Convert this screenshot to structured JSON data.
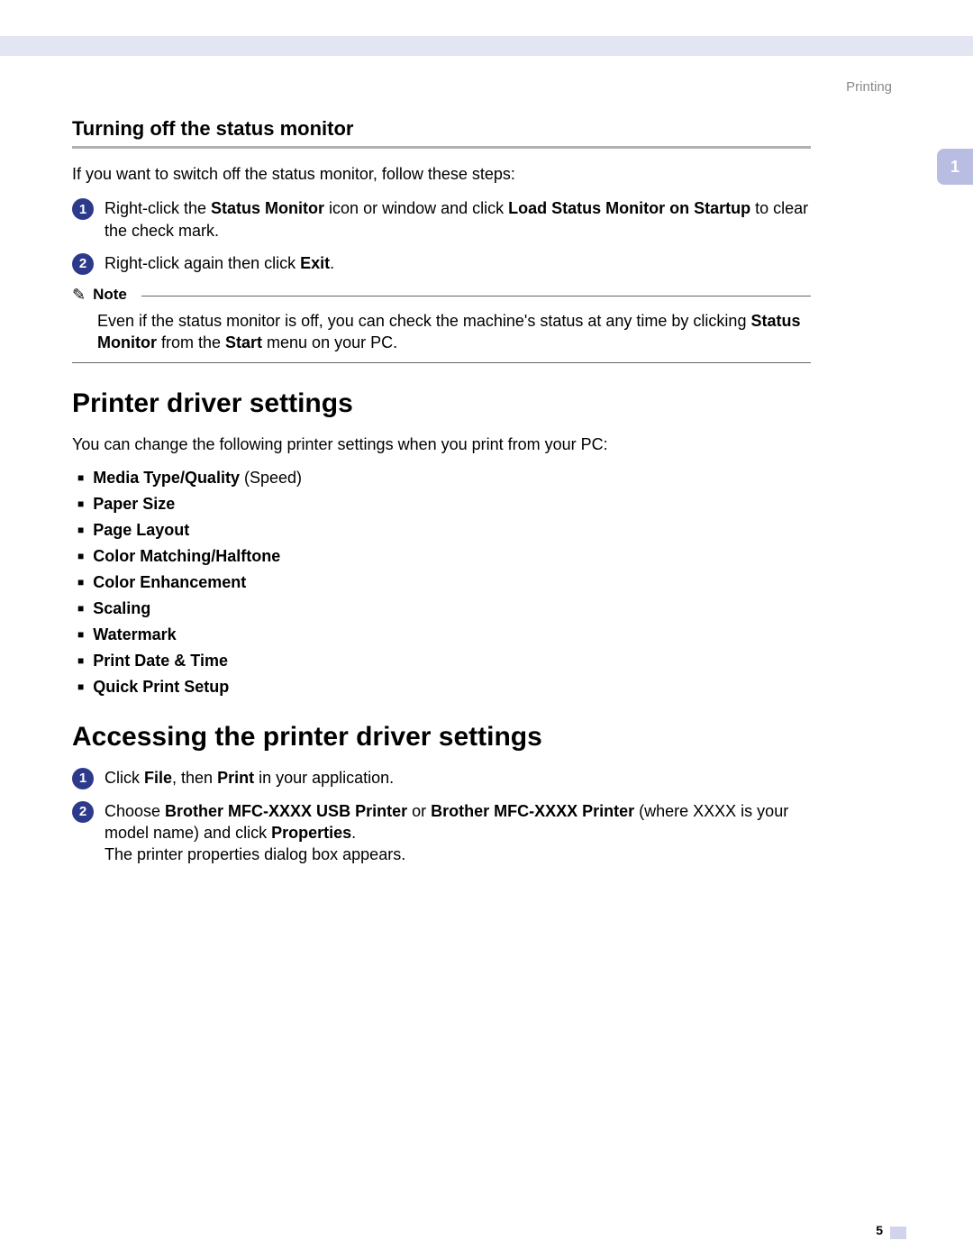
{
  "header": {
    "section_label": "Printing",
    "chapter_tab": "1"
  },
  "sub1": {
    "title": "Turning off the status monitor",
    "intro": "If you want to switch off the status monitor, follow these steps:",
    "step1": {
      "num": "1",
      "pre": "Right-click the ",
      "b1": "Status Monitor",
      "mid": " icon or window and click ",
      "b2": "Load Status Monitor on Startup",
      "post": " to clear the check mark."
    },
    "step2": {
      "num": "2",
      "pre": "Right-click again then click ",
      "b1": "Exit",
      "post": "."
    }
  },
  "note": {
    "label": "Note",
    "body_pre": "Even if the status monitor is off, you can check the machine's status at any time by clicking ",
    "body_b1": "Status Monitor",
    "body_mid": " from the ",
    "body_b2": "Start",
    "body_post": " menu on your PC."
  },
  "sec2": {
    "title": "Printer driver settings",
    "intro": "You can change the following printer settings when you print from your PC:",
    "items": [
      {
        "bold": "Media Type/Quality",
        "rest": " (Speed)"
      },
      {
        "bold": "Paper Size",
        "rest": ""
      },
      {
        "bold": "Page Layout",
        "rest": ""
      },
      {
        "bold": "Color Matching/Halftone",
        "rest": ""
      },
      {
        "bold": "Color Enhancement",
        "rest": ""
      },
      {
        "bold": "Scaling",
        "rest": ""
      },
      {
        "bold": "Watermark",
        "rest": ""
      },
      {
        "bold": "Print Date & Time",
        "rest": ""
      },
      {
        "bold": "Quick Print Setup",
        "rest": ""
      }
    ]
  },
  "sec3": {
    "title": "Accessing the printer driver settings",
    "step1": {
      "num": "1",
      "pre": "Click ",
      "b1": "File",
      "mid": ", then ",
      "b2": "Print",
      "post": " in your application."
    },
    "step2": {
      "num": "2",
      "pre": "Choose ",
      "b1": "Brother MFC-XXXX USB Printer",
      "mid": " or ",
      "b2": "Brother MFC-XXXX Printer",
      "post1": " (where XXXX is your model name) and click ",
      "b3": "Properties",
      "post2": ".",
      "line2": "The printer properties dialog box appears."
    }
  },
  "footer": {
    "page_number": "5"
  }
}
